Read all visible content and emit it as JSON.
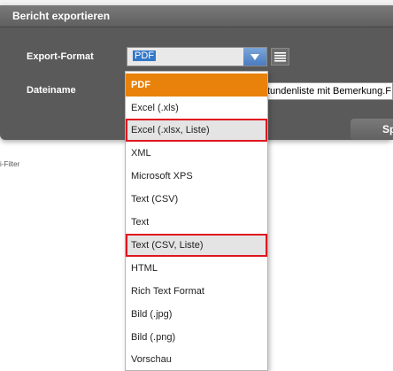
{
  "background": {
    "filter_text": "i-Filter"
  },
  "dialog": {
    "title": "Bericht exportieren",
    "export_format_label": "Export-Format",
    "export_format_value": "PDF",
    "filename_label": "Dateiname",
    "filename_value": "tundenliste mit Bemerkung.F",
    "button_label": "Sp"
  },
  "dropdown": {
    "options": [
      "PDF",
      "Excel (.xls)",
      "Excel (.xlsx, Liste)",
      "XML",
      "Microsoft XPS",
      "Text (CSV)",
      "Text",
      "Text (CSV, Liste)",
      "HTML",
      "Rich Text Format",
      "Bild (.jpg)",
      "Bild (.png)",
      "Vorschau"
    ],
    "selected_option": "PDF",
    "highlighted_options": [
      "Excel (.xlsx, Liste)",
      "Text (CSV, Liste)"
    ]
  },
  "icons": {
    "combo_arrow": "chevron-down-icon",
    "list_toggle": "list-icon"
  },
  "colors": {
    "selected_option": "#e8820a",
    "annotation_frame": "#e0161f",
    "dialog_bg": "#5a5a5a"
  }
}
